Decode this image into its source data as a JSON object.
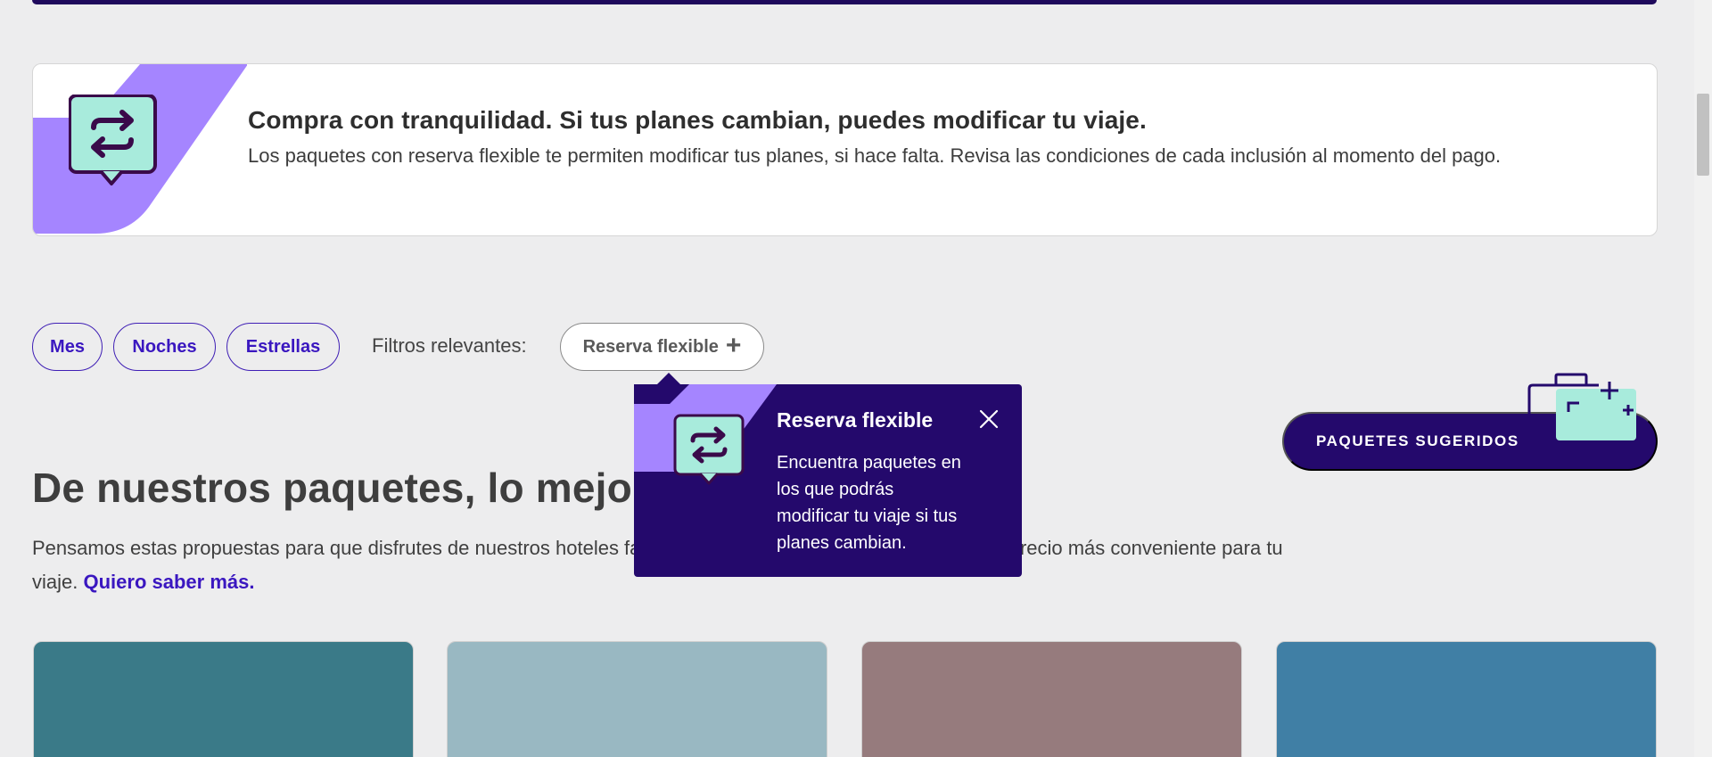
{
  "banner": {
    "title": "Compra con tranquilidad. Si tus planes cambian, puedes modificar tu viaje.",
    "text": "Los paquetes con reserva flexible te permiten modificar tus planes, si hace falta. Revisa las condiciones de cada inclusión al momento del pago.",
    "icon": "swap-arrows-icon"
  },
  "filters": {
    "chips": [
      "Mes",
      "Noches",
      "Estrellas"
    ],
    "relevant_label": "Filtros relevantes:",
    "flexible_chip": "Reserva flexible",
    "flexible_icon": "plus-icon"
  },
  "tooltip": {
    "title": "Reserva flexible",
    "text": "Encuentra paquetes en los que podrás modificar tu viaje si tus planes cambian.",
    "close_icon": "close-icon"
  },
  "suggested": {
    "label": "PAQUETES SUGERIDOS",
    "icon": "suitcase-icon"
  },
  "section": {
    "title": "De nuestros paquetes, lo mejor",
    "desc_before": "Pensamos estas propuestas para que disfrutes de nuestros hoteles favoritos, con experiencias imperdibles, y el precio más conveniente para tu viaje. ",
    "learn_more": "Quiero saber más."
  },
  "cards": [
    {
      "color": "#3a7a88"
    },
    {
      "color": "#99b8c2"
    },
    {
      "color": "#967b7d"
    },
    {
      "color": "#407fa5"
    }
  ],
  "colors": {
    "brand_dark": "#24096c",
    "accent_purple": "#a585ff",
    "mint": "#a8ebdc",
    "link": "#3a17c0"
  }
}
